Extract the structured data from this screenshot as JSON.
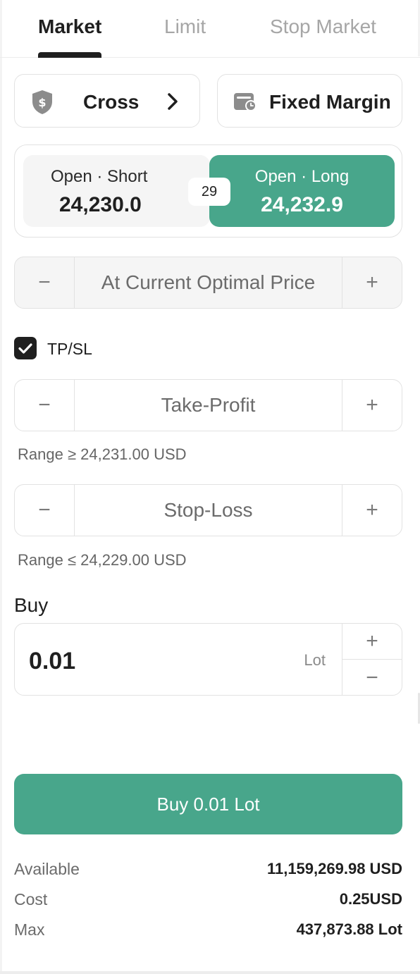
{
  "tabs": [
    {
      "label": "Market",
      "active": true
    },
    {
      "label": "Limit",
      "active": false
    },
    {
      "label": "Stop Market",
      "active": false
    }
  ],
  "margin_mode": {
    "cross_label": "Cross",
    "fixed_label": "Fixed Margin",
    "shield_icon_glyph": "$"
  },
  "direction": {
    "short": {
      "title": "Open · Short",
      "price": "24,230.0"
    },
    "long": {
      "title": "Open · Long",
      "price": "24,232.9",
      "selected": true
    },
    "spread": "29"
  },
  "price_stepper": {
    "minus": "−",
    "value": "At Current Optimal Price",
    "plus": "+"
  },
  "tpsl": {
    "label": "TP/SL",
    "checked": true
  },
  "take_profit": {
    "minus": "−",
    "placeholder": "Take-Profit",
    "plus": "+",
    "range": "Range ≥ 24,231.00 USD"
  },
  "stop_loss": {
    "minus": "−",
    "placeholder": "Stop-Loss",
    "plus": "+",
    "range": "Range ≤ 24,229.00 USD"
  },
  "order": {
    "side_label": "Buy",
    "quantity": "0.01",
    "unit": "Lot",
    "plus": "+",
    "minus": "−",
    "submit_label": "Buy 0.01 Lot"
  },
  "summary": [
    {
      "label": "Available",
      "value": "11,159,269.98 USD"
    },
    {
      "label": "Cost",
      "value": "0.25USD"
    },
    {
      "label": "Max",
      "value": "437,873.88 Lot"
    }
  ],
  "colors": {
    "accent_green": "#48a68b",
    "text_primary": "#1f1f1f",
    "text_muted": "#a6a6a6",
    "border": "#e2e2e2",
    "panel_gray": "#f5f5f5",
    "icon_gray": "#8c8c8c"
  },
  "icons": {
    "cross_icon": "shield-dollar-icon",
    "cross_arrow": "chevron-right-icon",
    "fixed_icon": "wallet-clock-icon",
    "checkbox": "checkmark-icon"
  }
}
